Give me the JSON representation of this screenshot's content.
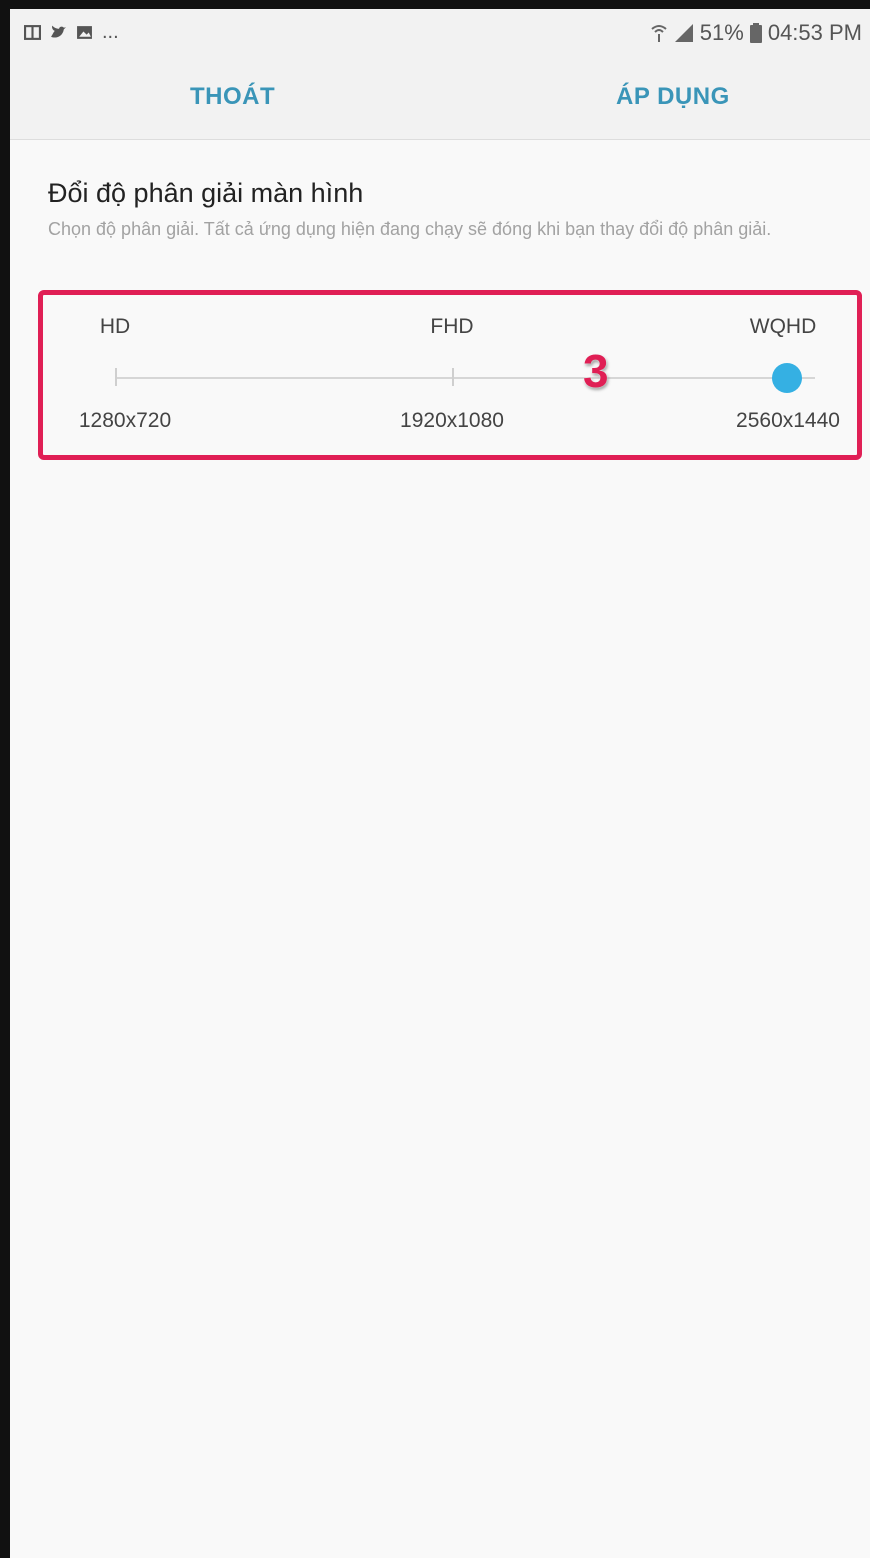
{
  "status_bar": {
    "left_icons": [
      "book-icon",
      "twitter-bird-icon",
      "image-icon"
    ],
    "more_indicator": "...",
    "right_icons": [
      "wifi-icon",
      "signal-icon",
      "battery-icon"
    ],
    "battery_text": "51%",
    "time": "04:53 PM"
  },
  "action_bar": {
    "exit_label": "THOÁT",
    "apply_label": "ÁP DỤNG",
    "accent_color": "#3a95b8"
  },
  "screen": {
    "title": "Đổi độ phân giải màn hình",
    "description": "Chọn độ phân giải. Tất cả ứng dụng hiện đang chạy sẽ đóng khi bạn thay đổi độ phân giải."
  },
  "resolution_slider": {
    "options": [
      {
        "name": "HD",
        "resolution": "1280x720"
      },
      {
        "name": "FHD",
        "resolution": "1920x1080"
      },
      {
        "name": "WQHD",
        "resolution": "2560x1440"
      }
    ],
    "selected_index": 2,
    "thumb_color": "#35b0e3",
    "highlight_color": "#e01f55",
    "step_number": "3"
  }
}
